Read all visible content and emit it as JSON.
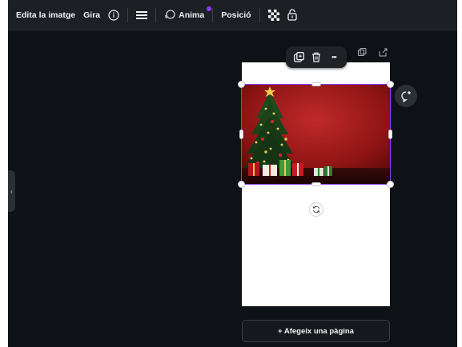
{
  "toolbar": {
    "edit_image_label": "Edita la imatge",
    "rotate_label": "Gira",
    "animate_label": "Anima",
    "position_label": "Posició"
  },
  "bottom": {
    "add_page_label": "+ Afegeix una pàgina"
  },
  "floating_toolbar": {
    "more_label": "•••"
  },
  "colors": {
    "accent": "#8b3dff",
    "toolbar_bg": "#1c1f24",
    "canvas_bg": "#0e1115"
  },
  "icons": {
    "info": "info-icon",
    "lines": "line-spacing-icon",
    "animate": "animate-icon",
    "transparency": "transparency-icon",
    "lock": "lock-icon",
    "duplicate": "duplicate-icon",
    "trash": "trash-icon",
    "comment": "add-comment-icon",
    "rotate": "rotate-icon",
    "share": "share-icon"
  }
}
